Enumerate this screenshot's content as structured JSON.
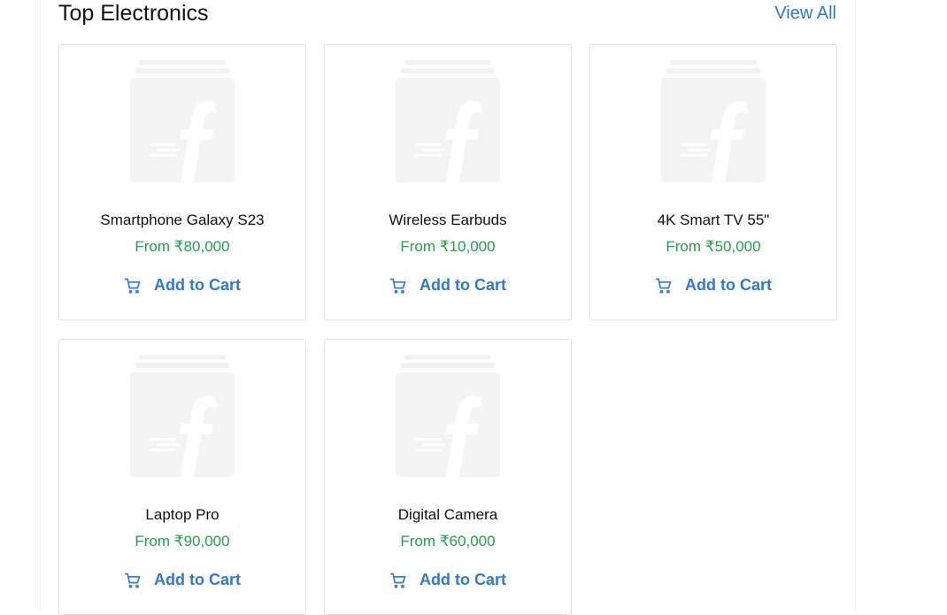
{
  "section": {
    "title": "Top Electronics",
    "view_all_label": "View All"
  },
  "products": [
    {
      "name": "Smartphone Galaxy S23",
      "price": "From ₹80,000",
      "cart_label": "Add to Cart"
    },
    {
      "name": "Wireless Earbuds",
      "price": "From ₹10,000",
      "cart_label": "Add to Cart"
    },
    {
      "name": "4K Smart TV 55\"",
      "price": "From ₹50,000",
      "cart_label": "Add to Cart"
    },
    {
      "name": "Laptop Pro",
      "price": "From ₹90,000",
      "cart_label": "Add to Cart"
    },
    {
      "name": "Digital Camera",
      "price": "From ₹60,000",
      "cart_label": "Add to Cart"
    }
  ],
  "icons": {
    "thumbnail": "flipkart-placeholder-icon",
    "cart": "cart-icon"
  },
  "colors": {
    "accent": "#2f78d8",
    "price": "#22a04a",
    "placeholder": "#f1f1f1"
  }
}
